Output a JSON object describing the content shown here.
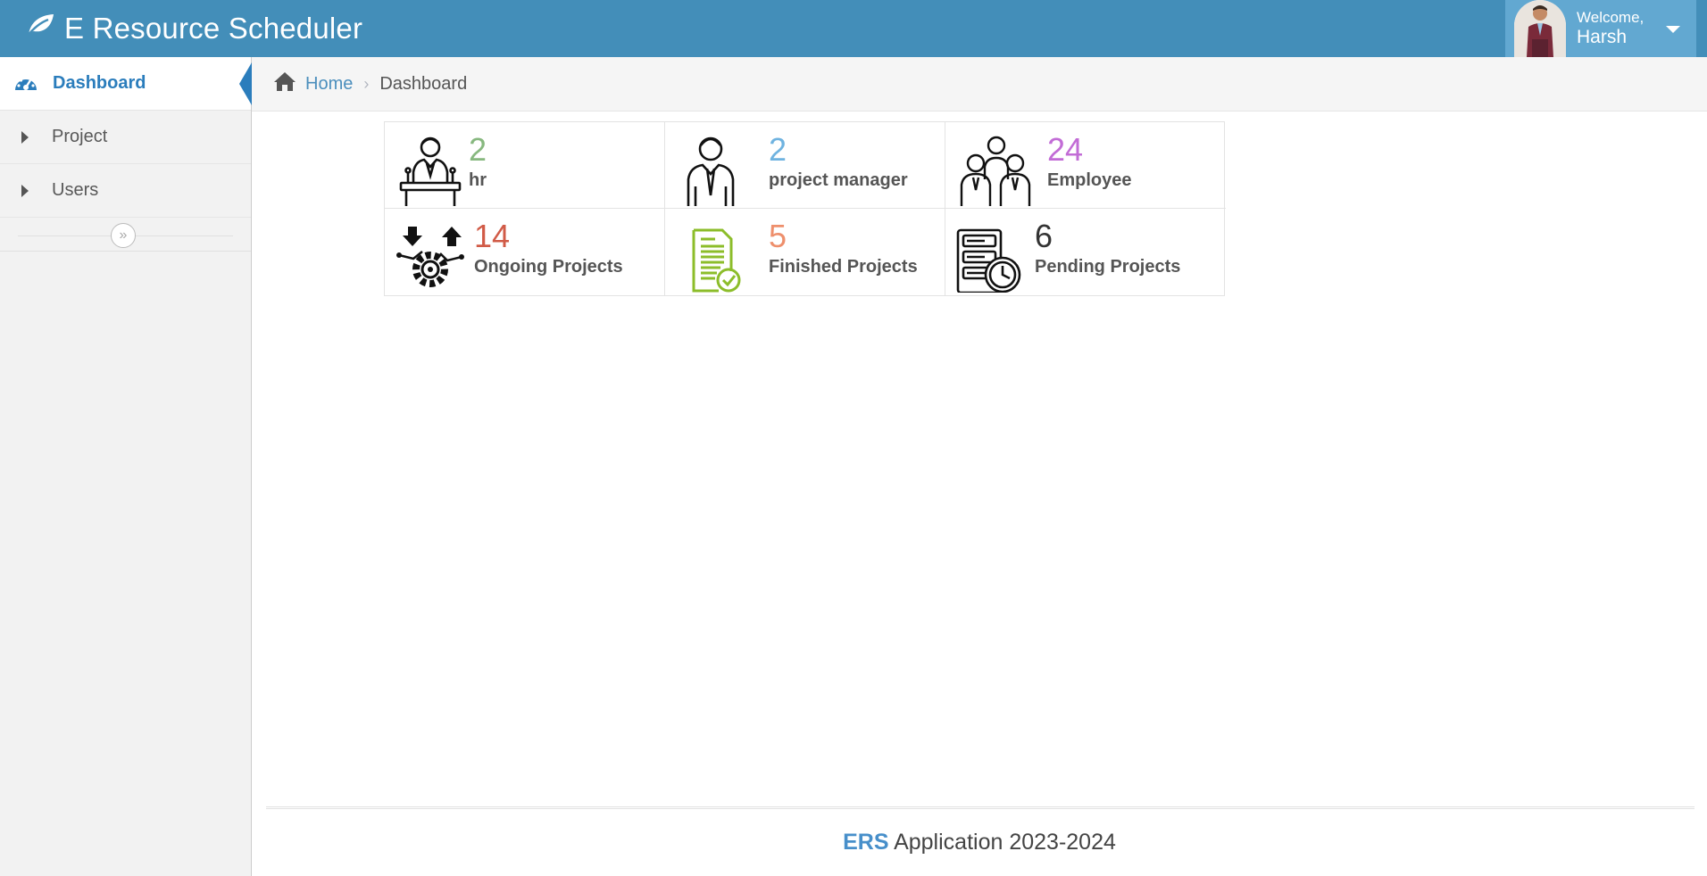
{
  "app": {
    "title": "E Resource Scheduler"
  },
  "user": {
    "welcome": "Welcome,",
    "name": "Harsh"
  },
  "sidebar": {
    "items": [
      {
        "label": "Dashboard",
        "icon": "tachometer-icon",
        "active": true
      },
      {
        "label": "Project",
        "icon": "caret-right-icon",
        "active": false
      },
      {
        "label": "Users",
        "icon": "caret-right-icon",
        "active": false
      }
    ],
    "collapse_icon": "double-chevron-right-icon"
  },
  "breadcrumb": {
    "home": "Home",
    "current": "Dashboard"
  },
  "stats": [
    {
      "value": "2",
      "label": "hr",
      "color": "#87b87f",
      "icon": "speaker-podium-icon"
    },
    {
      "value": "2",
      "label": "project manager",
      "color": "#6fb3e0",
      "icon": "manager-icon"
    },
    {
      "value": "24",
      "label": "Employee",
      "color": "#c26cd6",
      "icon": "team-icon"
    },
    {
      "value": "14",
      "label": "Ongoing Projects",
      "color": "#d15b47",
      "icon": "gear-process-icon"
    },
    {
      "value": "5",
      "label": "Finished Projects",
      "color": "#ee8f6c",
      "icon": "document-check-icon"
    },
    {
      "value": "6",
      "label": "Pending Projects",
      "color": "#333333",
      "icon": "server-clock-icon"
    }
  ],
  "footer": {
    "brand": "ERS",
    "text": "Application 2023-2024"
  },
  "colors": {
    "navbar": "#438eb9",
    "user_menu": "#62a8d1",
    "active_link": "#2b7dbc"
  }
}
